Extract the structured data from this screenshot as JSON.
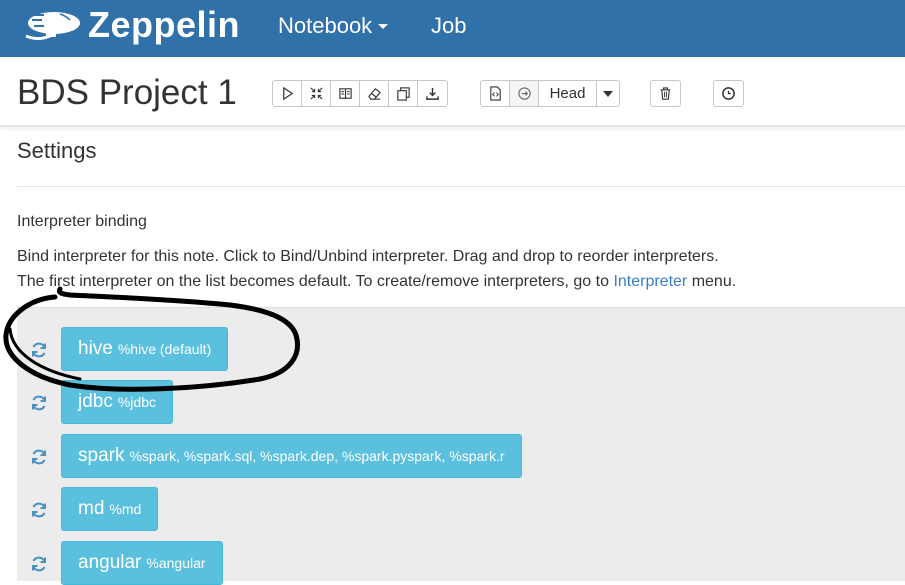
{
  "navbar": {
    "brand": "Zeppelin",
    "menu": [
      {
        "label": "Notebook",
        "has_caret": true
      },
      {
        "label": "Job",
        "has_caret": false
      }
    ]
  },
  "note": {
    "title": "BDS Project 1",
    "toolbar": {
      "group1": [
        "play-icon",
        "collapse-icon",
        "book-icon",
        "eraser-icon",
        "copy-icon",
        "download-icon"
      ],
      "group2": [
        "code-file-icon",
        "arrow-circle-icon"
      ],
      "revision_label": "Head",
      "group3": [
        "trash-icon"
      ],
      "group4": [
        "clock-icon"
      ]
    }
  },
  "settings": {
    "title": "Settings",
    "binding_title": "Interpreter binding",
    "desc_line1": "Bind interpreter for this note. Click to Bind/Unbind interpreter. Drag and drop to reorder interpreters.",
    "desc_line2_prefix": "The first interpreter on the list becomes default. To create/remove interpreters, go to ",
    "desc_link": "Interpreter",
    "desc_line2_suffix": " menu.",
    "interpreters": [
      {
        "name": "hive",
        "aliases": "%hive (default)"
      },
      {
        "name": "jdbc",
        "aliases": "%jdbc"
      },
      {
        "name": "spark",
        "aliases": "%spark, %spark.sql, %spark.dep, %spark.pyspark, %spark.r"
      },
      {
        "name": "md",
        "aliases": "%md"
      },
      {
        "name": "angular",
        "aliases": "%angular"
      }
    ]
  },
  "colors": {
    "navbar": "#3071a9",
    "interpreter_button": "#5bc0de",
    "link": "#3a7fc1",
    "panel": "#ececec"
  }
}
